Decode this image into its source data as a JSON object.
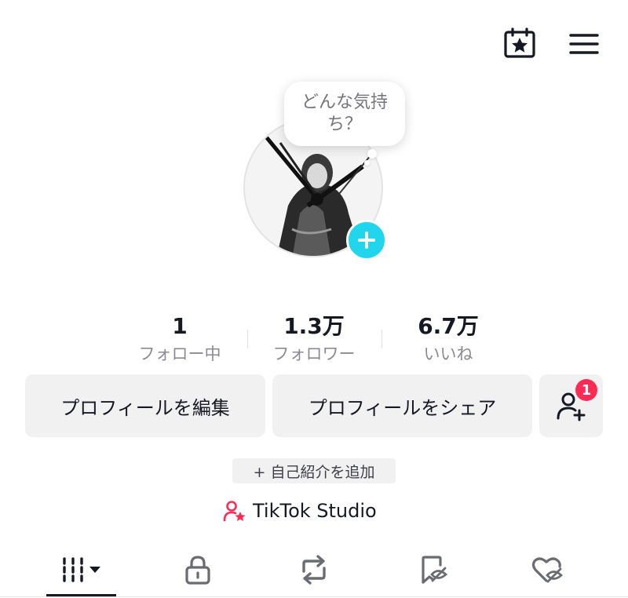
{
  "header": {
    "calendar_icon": "calendar-star-icon",
    "menu_icon": "hamburger-menu-icon"
  },
  "avatar": {
    "bubble_text_line1": "どんな気持",
    "bubble_text_line2": "ち？",
    "add_icon": "plus-icon",
    "add_color": "#20d5ec"
  },
  "stats": [
    {
      "value": "1",
      "label": "フォロー中"
    },
    {
      "value": "1.3万",
      "label": "フォロワー"
    },
    {
      "value": "6.7万",
      "label": "いいね"
    }
  ],
  "actions": {
    "edit_profile": "プロフィールを編集",
    "share_profile": "プロフィールをシェア",
    "add_friend_badge": "1",
    "badge_color": "#fe2c55"
  },
  "bio": {
    "add_label": "+ 自己紹介を追加"
  },
  "studio": {
    "label": "TikTok Studio",
    "icon_color": "#fe2c55"
  },
  "tabs": [
    {
      "name": "videos",
      "icon": "grid-bars-icon",
      "active": true
    },
    {
      "name": "private",
      "icon": "lock-icon"
    },
    {
      "name": "reposts",
      "icon": "repost-icon"
    },
    {
      "name": "favorites",
      "icon": "bookmark-hidden-icon"
    },
    {
      "name": "liked",
      "icon": "heart-hidden-icon"
    }
  ]
}
